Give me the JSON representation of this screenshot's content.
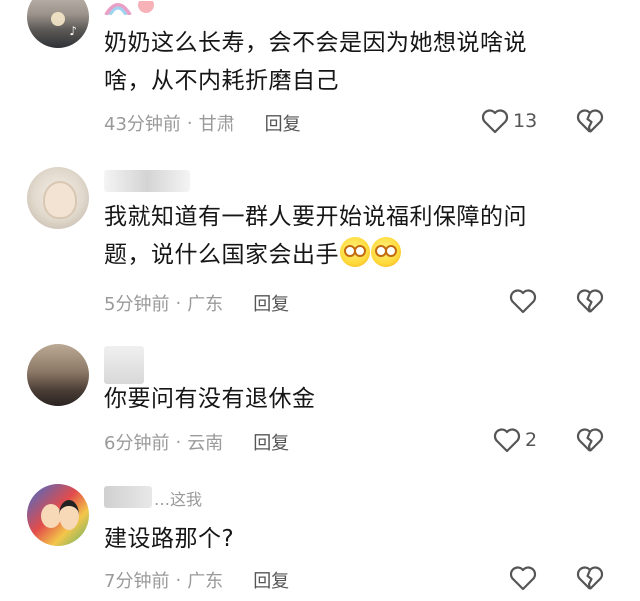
{
  "comments": [
    {
      "text_lines": [
        "奶奶这么长寿，会不会是因为她想说啥说",
        "啥，从不内耗折磨自己"
      ],
      "time": "43分钟前",
      "location": "甘肃",
      "reply_label": "回复",
      "likes": "13"
    },
    {
      "text_lines": [
        "我就知道有一群人要开始说福利保障的问",
        "题，说什么国家会出手"
      ],
      "time": "5分钟前",
      "location": "广东",
      "reply_label": "回复",
      "likes": ""
    },
    {
      "text_lines": [
        "你要问有没有退休金"
      ],
      "time": "6分钟前",
      "location": "云南",
      "reply_label": "回复",
      "likes": "2"
    },
    {
      "name_visible": "…这我",
      "text_lines": [
        "建设路那个?"
      ],
      "time": "7分钟前",
      "location": "广东",
      "reply_label": "回复",
      "likes": ""
    }
  ],
  "separator": "·",
  "icons": {
    "like": "heart-outline-icon",
    "dislike": "broken-heart-icon",
    "emoji": "flushed-face-emoji"
  }
}
